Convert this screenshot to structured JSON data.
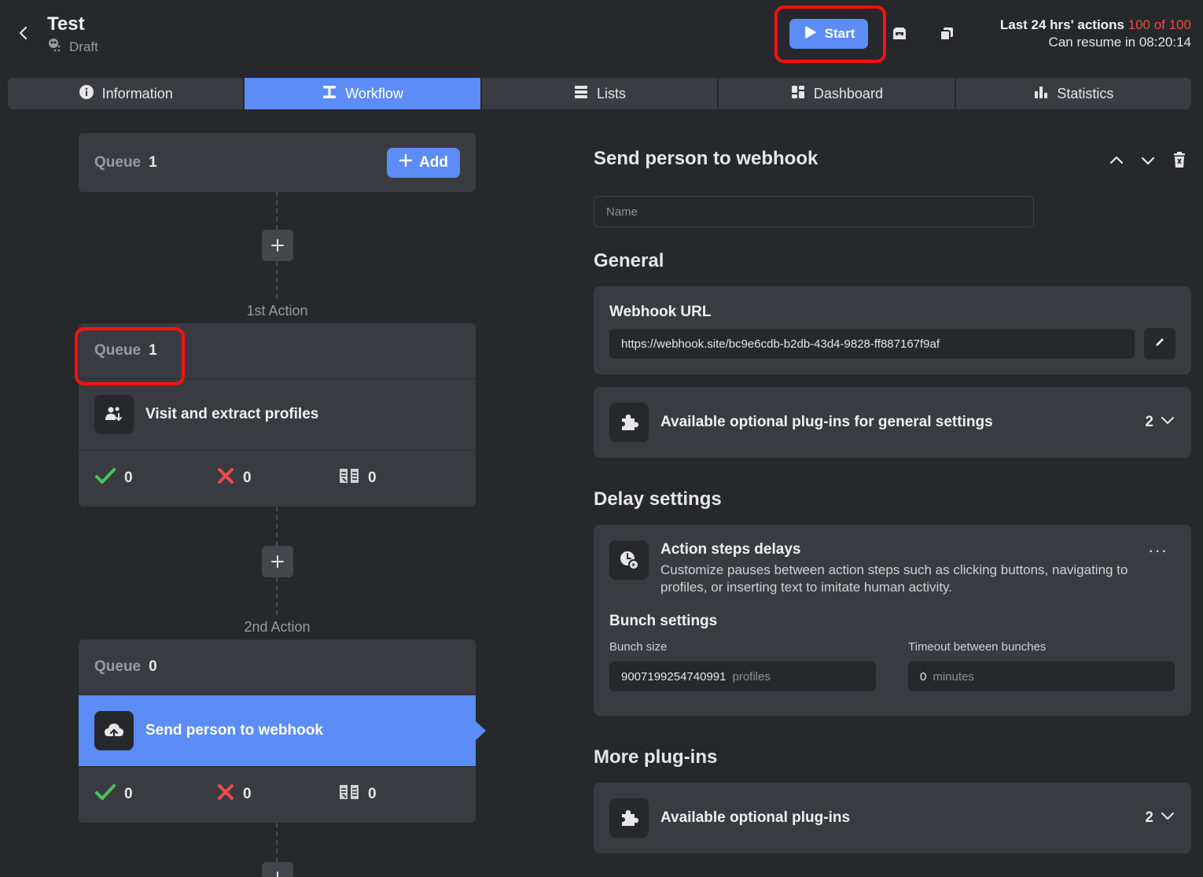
{
  "header": {
    "title": "Test",
    "status": "Draft",
    "start_label": "Start",
    "quota_prefix": "Last 24 hrs' actions",
    "quota_value": "100 of 100",
    "resume_text": "Can resume in 08:20:14"
  },
  "tabs": [
    {
      "label": "Information",
      "icon": "info-icon"
    },
    {
      "label": "Workflow",
      "icon": "workflow-icon",
      "active": true
    },
    {
      "label": "Lists",
      "icon": "list-icon"
    },
    {
      "label": "Dashboard",
      "icon": "dashboard-icon"
    },
    {
      "label": "Statistics",
      "icon": "bar-chart-icon"
    }
  ],
  "workflow": {
    "start_queue": {
      "label": "Queue",
      "count": "1",
      "add_label": "Add"
    },
    "actions": [
      {
        "step_label": "1st Action",
        "queue_label": "Queue",
        "queue_count": "1",
        "name": "Visit and extract profiles",
        "success": "0",
        "failed": "0",
        "skipped": "0"
      },
      {
        "step_label": "2nd Action",
        "queue_label": "Queue",
        "queue_count": "0",
        "name": "Send person to webhook",
        "success": "0",
        "failed": "0",
        "skipped": "0"
      }
    ]
  },
  "panel": {
    "title": "Send person to webhook",
    "name_placeholder": "Name",
    "general_heading": "General",
    "webhook_label": "Webhook URL",
    "webhook_url": "https://webhook.site/bc9e6cdb-b2db-43d4-9828-ff887167f9af",
    "general_plugins_label": "Available optional plug-ins for general settings",
    "general_plugins_count": "2",
    "delay_heading": "Delay settings",
    "delay_title": "Action steps delays",
    "delay_desc_1": "Customize pauses between action steps such as clicking buttons, navigating to",
    "delay_desc_2": "profiles, or inserting text to imitate human activity.",
    "bunch_heading": "Bunch settings",
    "bunch_size_label": "Bunch size",
    "bunch_size_value": "9007199254740991",
    "bunch_size_unit": "profiles",
    "timeout_label": "Timeout between bunches",
    "timeout_value": "0",
    "timeout_unit": "minutes",
    "more_heading": "More plug-ins",
    "more_plugins_label": "Available optional plug-ins",
    "more_plugins_count": "2"
  },
  "colors": {
    "accent": "#5c8cf5",
    "background": "#27282c",
    "card": "#3a3b41",
    "success": "#4cc35a",
    "danger": "#f04a48",
    "highlight": "#ff1010"
  }
}
